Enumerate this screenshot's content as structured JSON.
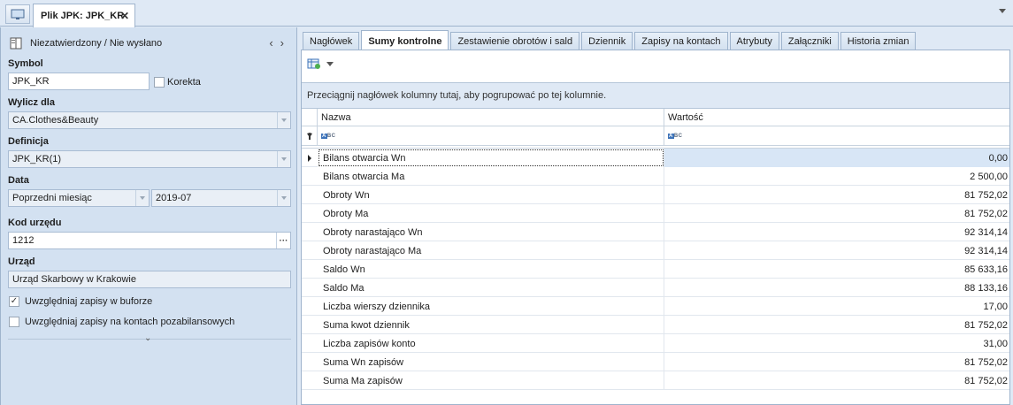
{
  "document_tab": {
    "title": "Plik JPK: JPK_KR"
  },
  "form": {
    "status": "Niezatwierdzony / Nie wysłano",
    "symbol_label": "Symbol",
    "symbol_value": "JPK_KR",
    "korekta_label": "Korekta",
    "wylicz_label": "Wylicz dla",
    "wylicz_value": "CA.Clothes&Beauty",
    "definicja_label": "Definicja",
    "definicja_value": "JPK_KR(1)",
    "data_label": "Data",
    "data_period": "Poprzedni miesiąc",
    "data_month": "2019-07",
    "kod_label": "Kod urzędu",
    "kod_value": "1212",
    "urzad_label": "Urząd",
    "urzad_value": "Urząd Skarbowy w Krakowie",
    "chk_bufor_label": "Uwzględniaj zapisy w buforze",
    "chk_bufor_checked": true,
    "chk_pozabil_label": "Uwzględniaj zapisy na kontach pozabilansowych",
    "chk_pozabil_checked": false
  },
  "tabs": [
    {
      "label": "Nagłówek"
    },
    {
      "label": "Sumy kontrolne",
      "active": true
    },
    {
      "label": "Zestawienie obrotów i sald"
    },
    {
      "label": "Dziennik"
    },
    {
      "label": "Zapisy na kontach"
    },
    {
      "label": "Atrybuty"
    },
    {
      "label": "Załączniki"
    },
    {
      "label": "Historia zmian"
    }
  ],
  "grid": {
    "group_hint": "Przeciągnij nagłówek kolumny tutaj, aby pogrupować po tej kolumnie.",
    "col_name": "Nazwa",
    "col_value": "Wartość",
    "rows": [
      {
        "name": "Bilans otwarcia Wn",
        "value": "0,00"
      },
      {
        "name": "Bilans otwarcia Ma",
        "value": "2 500,00"
      },
      {
        "name": "Obroty Wn",
        "value": "81 752,02"
      },
      {
        "name": "Obroty Ma",
        "value": "81 752,02"
      },
      {
        "name": "Obroty narastająco Wn",
        "value": "92 314,14"
      },
      {
        "name": "Obroty narastająco Ma",
        "value": "92 314,14"
      },
      {
        "name": "Saldo Wn",
        "value": "85 633,16"
      },
      {
        "name": "Saldo Ma",
        "value": "88 133,16"
      },
      {
        "name": "Liczba wierszy dziennika",
        "value": "17,00"
      },
      {
        "name": "Suma kwot dziennik",
        "value": "81 752,02"
      },
      {
        "name": "Liczba zapisów konto",
        "value": "31,00"
      },
      {
        "name": "Suma Wn zapisów",
        "value": "81 752,02"
      },
      {
        "name": "Suma Ma zapisów",
        "value": "81 752,02"
      }
    ]
  }
}
